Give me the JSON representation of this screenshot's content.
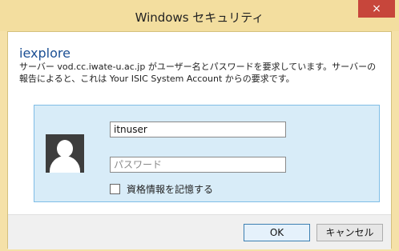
{
  "window": {
    "title": "Windows セキュリティ",
    "close_glyph": "×"
  },
  "dialog": {
    "app_name": "iexplore",
    "message": "サーバー vod.cc.iwate-u.ac.jp がユーザー名とパスワードを要求しています。サーバーの報告によると、これは Your ISIC System Account からの要求です。"
  },
  "credentials": {
    "username_value": "itnuser",
    "password_placeholder": "パスワード",
    "remember_label": "資格情報を記憶する",
    "remember_checked": false
  },
  "buttons": {
    "ok_label": "OK",
    "cancel_label": "キャンセル"
  },
  "icons": {
    "avatar": "user-avatar-icon",
    "close": "close-icon"
  },
  "colors": {
    "titlebar": "#f3de9f",
    "close": "#c7463b",
    "accent_text": "#1b4f94",
    "credential_panel": "#d8ecf8",
    "credential_border": "#7fbde6"
  }
}
